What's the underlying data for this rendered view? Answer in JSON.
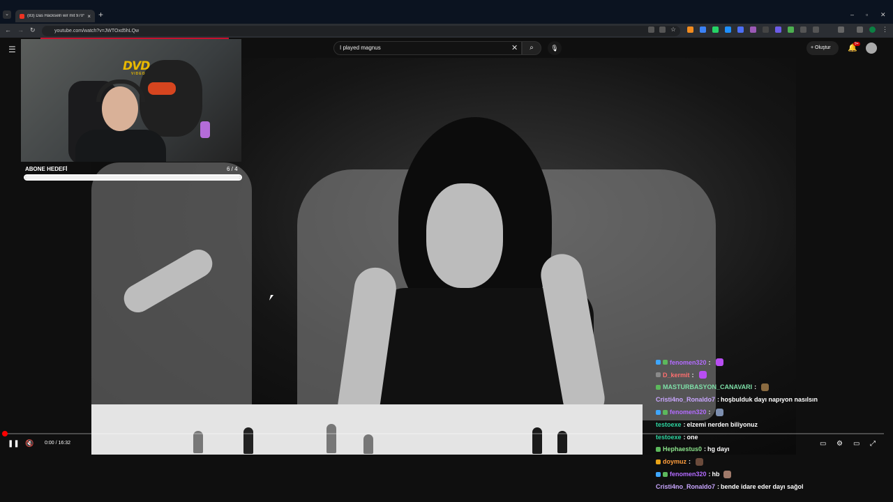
{
  "browser": {
    "tab_title": "(83) Das Häckseln wir mit 970°",
    "url": "youtube.com/watch?v=JWTOxd5hLQw"
  },
  "youtube": {
    "search_query": "I played magnus",
    "create_label": "Oluştur",
    "notification_count": "9+"
  },
  "overlay": {
    "dvd_logo": "DVD",
    "dvd_sub": "VIDEO",
    "sub_goal_label": "ABONE HEDEFİ",
    "sub_goal_count": "6 / 4",
    "sub_goal_progress_fraction": 1.0
  },
  "player": {
    "time": "0:00 / 16:32",
    "progress_fraction": 0.002
  },
  "chat": [
    {
      "badges": [
        "#3ea6ff",
        "#5cb85c"
      ],
      "user": "fenomen320",
      "color": "#b36bff",
      "text": "",
      "emote": "#b84ef2"
    },
    {
      "badges": [
        "#8a8a8a"
      ],
      "user": "D_kermit",
      "color": "#ff6f6f",
      "text": "",
      "emote": "#b84ef2"
    },
    {
      "badges": [
        "#5cb85c"
      ],
      "user": "MASTURBASYON_CANAVARI",
      "color": "#7ee0a8",
      "text": "",
      "emote": "#8a6a40"
    },
    {
      "badges": [],
      "user": "Cristi4no_Ronaldo7",
      "color": "#c9a6ff",
      "text": "hoşbulduk dayı napıyon nasılsın",
      "emote": ""
    },
    {
      "badges": [
        "#3ea6ff",
        "#5cb85c"
      ],
      "user": "fenomen320",
      "color": "#b36bff",
      "text": "",
      "emote": "#7d8fb0"
    },
    {
      "badges": [],
      "user": "testoexe",
      "color": "#2dd4a0",
      "text": "elzemi nerden biliyonuz",
      "emote": ""
    },
    {
      "badges": [],
      "user": "testoexe",
      "color": "#2dd4a0",
      "text": "one",
      "emote": ""
    },
    {
      "badges": [
        "#5cb85c"
      ],
      "user": "Hephaestus0",
      "color": "#8ce58c",
      "text": "hg dayı",
      "emote": ""
    },
    {
      "badges": [
        "#e8a317"
      ],
      "user": "doymuz",
      "color": "#ff9e3d",
      "text": "",
      "emote": "#6b4b3b"
    },
    {
      "badges": [
        "#3ea6ff",
        "#5cb85c"
      ],
      "user": "fenomen320",
      "color": "#b36bff",
      "text": "hb",
      "emote": "#a07a6a"
    },
    {
      "badges": [],
      "user": "Cristi4no_Ronaldo7",
      "color": "#c9a6ff",
      "text": "bende idare eder dayı sağol",
      "emote": ""
    }
  ]
}
